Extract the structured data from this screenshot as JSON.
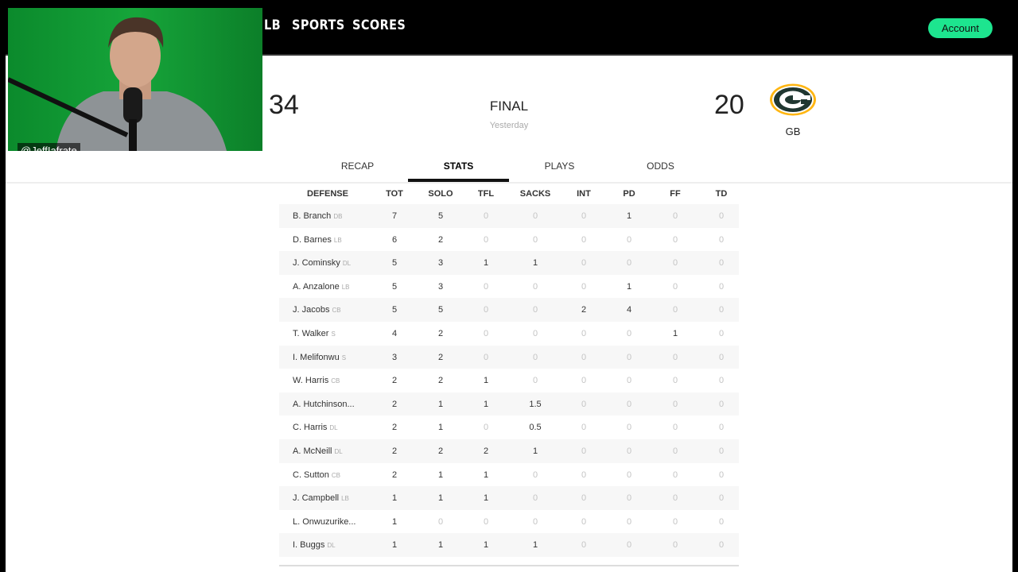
{
  "nav": {
    "links": [
      "LB",
      "SPORTS",
      "SCORES"
    ],
    "account": "Account"
  },
  "game": {
    "away_score": "34",
    "status": "FINAL",
    "when": "Yesterday",
    "home_score": "20",
    "home_abbr": "GB"
  },
  "tabs": [
    "RECAP",
    "STATS",
    "PLAYS",
    "ODDS"
  ],
  "active_tab": "STATS",
  "table": {
    "headers": [
      "DEFENSE",
      "TOT",
      "SOLO",
      "TFL",
      "SACKS",
      "INT",
      "PD",
      "FF",
      "TD"
    ],
    "rows": [
      {
        "name": "B. Branch",
        "pos": "DB",
        "stats": [
          "7",
          "5",
          "0",
          "0",
          "0",
          "1",
          "0",
          "0"
        ]
      },
      {
        "name": "D. Barnes",
        "pos": "LB",
        "stats": [
          "6",
          "2",
          "0",
          "0",
          "0",
          "0",
          "0",
          "0"
        ]
      },
      {
        "name": "J. Cominsky",
        "pos": "DL",
        "stats": [
          "5",
          "3",
          "1",
          "1",
          "0",
          "0",
          "0",
          "0"
        ]
      },
      {
        "name": "A. Anzalone",
        "pos": "LB",
        "stats": [
          "5",
          "3",
          "0",
          "0",
          "0",
          "1",
          "0",
          "0"
        ]
      },
      {
        "name": "J. Jacobs",
        "pos": "CB",
        "stats": [
          "5",
          "5",
          "0",
          "0",
          "2",
          "4",
          "0",
          "0"
        ]
      },
      {
        "name": "T. Walker",
        "pos": "S",
        "stats": [
          "4",
          "2",
          "0",
          "0",
          "0",
          "0",
          "1",
          "0"
        ]
      },
      {
        "name": "I. Melifonwu",
        "pos": "S",
        "stats": [
          "3",
          "2",
          "0",
          "0",
          "0",
          "0",
          "0",
          "0"
        ]
      },
      {
        "name": "W. Harris",
        "pos": "CB",
        "stats": [
          "2",
          "2",
          "1",
          "0",
          "0",
          "0",
          "0",
          "0"
        ]
      },
      {
        "name": "A. Hutchinson...",
        "pos": "",
        "stats": [
          "2",
          "1",
          "1",
          "1.5",
          "0",
          "0",
          "0",
          "0"
        ]
      },
      {
        "name": "C. Harris",
        "pos": "DL",
        "stats": [
          "2",
          "1",
          "0",
          "0.5",
          "0",
          "0",
          "0",
          "0"
        ]
      },
      {
        "name": "A. McNeill",
        "pos": "DL",
        "stats": [
          "2",
          "2",
          "2",
          "1",
          "0",
          "0",
          "0",
          "0"
        ]
      },
      {
        "name": "C. Sutton",
        "pos": "CB",
        "stats": [
          "2",
          "1",
          "1",
          "0",
          "0",
          "0",
          "0",
          "0"
        ]
      },
      {
        "name": "J. Campbell",
        "pos": "LB",
        "stats": [
          "1",
          "1",
          "1",
          "0",
          "0",
          "0",
          "0",
          "0"
        ]
      },
      {
        "name": "L. Onwuzurike...",
        "pos": "",
        "stats": [
          "1",
          "0",
          "0",
          "0",
          "0",
          "0",
          "0",
          "0"
        ]
      },
      {
        "name": "I. Buggs",
        "pos": "DL",
        "stats": [
          "1",
          "1",
          "1",
          "1",
          "0",
          "0",
          "0",
          "0"
        ]
      }
    ]
  },
  "webcam": {
    "handle": "@JeffIafrate"
  },
  "colors": {
    "accent": "#1de58f",
    "packers_green": "#203731",
    "packers_gold": "#FFB612"
  }
}
